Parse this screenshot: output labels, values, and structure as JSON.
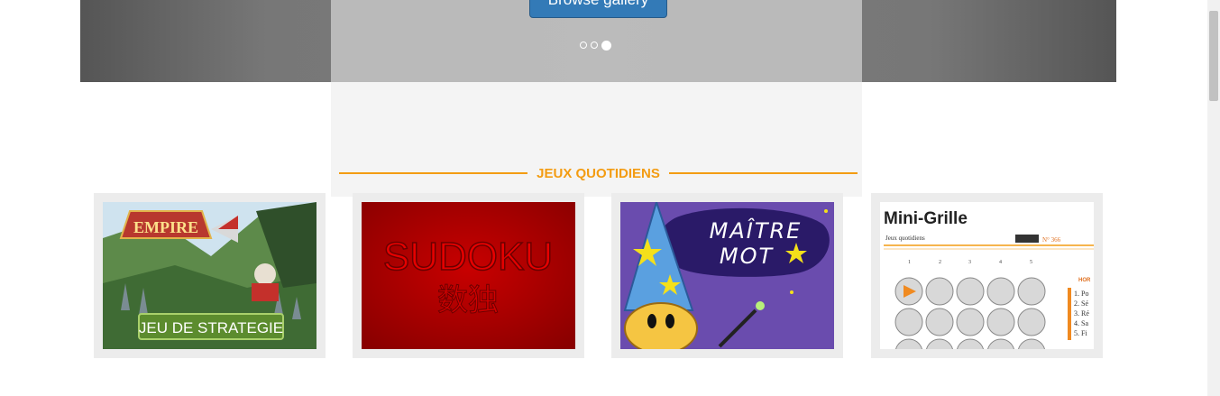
{
  "hero": {
    "button_label": "Browse gallery",
    "carousel": {
      "slides": 3,
      "active_index": 2
    }
  },
  "section": {
    "title": "JEUX QUOTIDIENS"
  },
  "games": [
    {
      "name": "Empire",
      "banner": "JEU DE STRATEGIE",
      "logo": "EMPIRE"
    },
    {
      "name": "Sudoku",
      "title": "SUDOKU",
      "subtitle": "数独"
    },
    {
      "name": "Maître Mot",
      "title_line1": "MAÎTRE",
      "title_line2": "MOT"
    },
    {
      "name": "Mini-Grille",
      "title": "Mini-Grille",
      "sub": "Jeux quotidiens",
      "number": "N° 366",
      "col_nums": [
        "1",
        "2",
        "3",
        "4",
        "5"
      ],
      "list": [
        "1. Po",
        "2. Sé",
        "3. Ré",
        "4. Sa",
        "5. Fi"
      ],
      "side_label": "HOR"
    }
  ],
  "colors": {
    "accent": "#f39c12",
    "button": "#337ab7",
    "sudoku_red": "#b00000",
    "wizard_purple": "#5b3fa0"
  }
}
